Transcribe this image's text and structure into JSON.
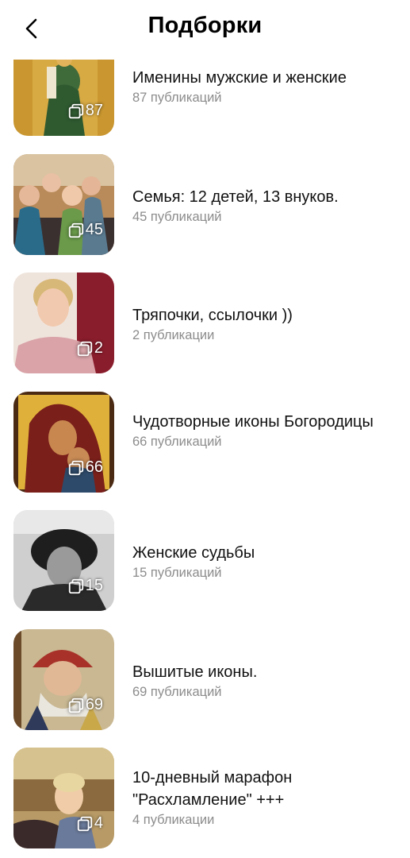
{
  "header": {
    "title": "Подборки"
  },
  "collections": [
    {
      "name": "Именины мужские и женские",
      "count_label": "87",
      "posts": "87 публикаций"
    },
    {
      "name": "Семья: 12 детей, 13 внуков.",
      "count_label": "45",
      "posts": "45 публикаций"
    },
    {
      "name": "Тряпочки, ссылочки ))",
      "count_label": "2",
      "posts": "2 публикации"
    },
    {
      "name": "Чудотворные иконы Богородицы",
      "count_label": "66",
      "posts": "66 публикаций"
    },
    {
      "name": "Женские судьбы",
      "count_label": "15",
      "posts": "15 публикаций"
    },
    {
      "name": "Вышитые иконы.",
      "count_label": "69",
      "posts": "69 публикаций"
    },
    {
      "name": "10-дневный марафон \"Расхламление\" +++",
      "count_label": "4",
      "posts": "4 публикации"
    }
  ],
  "icons": {
    "back": "chevron-left-icon",
    "count": "collection-stack-icon"
  }
}
